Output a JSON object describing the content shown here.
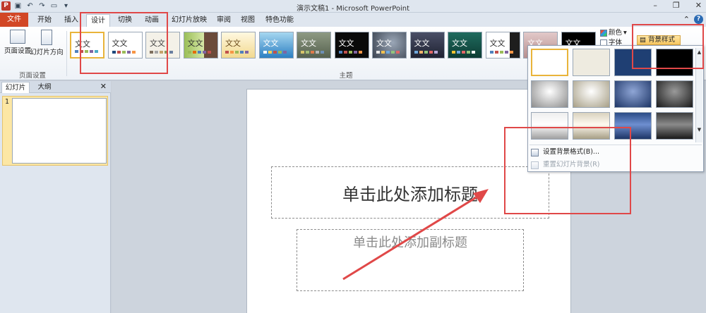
{
  "window": {
    "title": "演示文稿1 - Microsoft PowerPoint",
    "qat_icons": [
      "app-icon",
      "save-icon",
      "undo-icon",
      "redo-icon",
      "new-slide-icon",
      "customize-icon"
    ],
    "controls": {
      "minimize": "–",
      "restore": "❐",
      "close": "✕"
    }
  },
  "ribbon_tabs": [
    {
      "label": "文件",
      "kind": "file"
    },
    {
      "label": "开始"
    },
    {
      "label": "插入"
    },
    {
      "label": "设计",
      "active": true
    },
    {
      "label": "切换"
    },
    {
      "label": "动画"
    },
    {
      "label": "幻灯片放映"
    },
    {
      "label": "审阅"
    },
    {
      "label": "视图"
    },
    {
      "label": "特色功能"
    }
  ],
  "ribbon": {
    "page_setup": {
      "btn1": "页面设置",
      "btn2": "幻灯片方向",
      "group_label": "页面设置"
    },
    "themes": {
      "group_label": "主题",
      "thumb_text": "文文",
      "items": [
        {
          "bg": "#ffffff",
          "fg": "#333333",
          "bars": [
            "#4f81bd",
            "#c0504d",
            "#9bbb59",
            "#8064a2",
            "#4bacc6"
          ],
          "selected": true
        },
        {
          "bg": "#ffffff",
          "fg": "#333333",
          "bars": [
            "#1f497d",
            "#c0504d",
            "#9bbb59",
            "#8064a2",
            "#f79646"
          ]
        },
        {
          "bg": "#f4f1e8",
          "fg": "#444444",
          "bars": [
            "#7f6f5f",
            "#a5a5a5",
            "#c4a26b",
            "#8a9a5b",
            "#6a7fa0"
          ]
        },
        {
          "bg": "linear-gradient(90deg,#9bbf58,#d7e8a8 60%,#6b4b3a 60%)",
          "fg": "#333333",
          "bars": [
            "#9bbb59",
            "#e46c0a",
            "#4f81bd",
            "#8064a2",
            "#c0504d"
          ]
        },
        {
          "bg": "linear-gradient(#fff8e0,#f2d98f)",
          "fg": "#6b4a1a",
          "bars": [
            "#c0504d",
            "#f79646",
            "#9bbb59",
            "#4f81bd",
            "#8064a2"
          ]
        },
        {
          "bg": "linear-gradient(#a6d7f0,#2d7fc2)",
          "fg": "#ffffff",
          "bars": [
            "#ffffff",
            "#f7d154",
            "#c0504d",
            "#9bbb59",
            "#8064a2"
          ]
        },
        {
          "bg": "linear-gradient(#8e9a83,#56614f)",
          "fg": "#ffffff",
          "bars": [
            "#d9c46a",
            "#a5bd76",
            "#e07a4a",
            "#b7b7b7",
            "#6d8fb5"
          ]
        },
        {
          "bg": "#0a0a0a",
          "fg": "#ffffff",
          "bars": [
            "#4f81bd",
            "#c0504d",
            "#9bbb59",
            "#8064a2",
            "#f79646"
          ]
        },
        {
          "bg": "radial-gradient(circle at 60% 40%,#9aa6b6,#3b4350)",
          "fg": "#ffffff",
          "bars": [
            "#e9e9e9",
            "#f2c14e",
            "#6fa8dc",
            "#93c47d",
            "#e06666"
          ]
        },
        {
          "bg": "linear-gradient(#4a4f66,#1f2233)",
          "fg": "#ffffff",
          "bars": [
            "#6fa8dc",
            "#f6b26b",
            "#93c47d",
            "#e06666",
            "#b4a7d6"
          ]
        },
        {
          "bg": "linear-gradient(#1f6b5e,#0d3c34)",
          "fg": "#ffffff",
          "bars": [
            "#f1c232",
            "#6fa8dc",
            "#e06666",
            "#93c47d",
            "#ffffff"
          ]
        },
        {
          "bg": "linear-gradient(90deg,#ffffff 70%,#1e1e1e 70%)",
          "fg": "#333333",
          "bars": [
            "#4f81bd",
            "#c0504d",
            "#9bbb59",
            "#8064a2",
            "#f79646"
          ]
        },
        {
          "bg": "linear-gradient(#e2c9c9,#b79090)",
          "fg": "#ffffff",
          "bars": [
            "#c0504d",
            "#8064a2",
            "#4f81bd",
            "#9bbb59",
            "#f79646"
          ]
        },
        {
          "bg": "#000000",
          "fg": "#ffffff",
          "bars": [
            "#ffffff",
            "#888888",
            "#666666",
            "#444444",
            "#222222"
          ]
        }
      ]
    },
    "side": {
      "colors": "颜色",
      "fonts": "字体",
      "bg_style": "背景样式"
    }
  },
  "left_pane": {
    "tab_slides": "幻灯片",
    "tab_outline": "大纲",
    "close": "✕",
    "slide_number": "1"
  },
  "slide": {
    "title_placeholder": "单击此处添加标题",
    "subtitle_placeholder": "单击此处添加副标题"
  },
  "bg_dropdown": {
    "swatches": [
      {
        "bg": "#ffffff",
        "selected": true
      },
      {
        "bg": "#eeebe0"
      },
      {
        "bg": "#1f3f73"
      },
      {
        "bg": "#000000"
      },
      {
        "bg": "radial-gradient(ellipse at 50% 40%,#ffffff,#8c8c8c)"
      },
      {
        "bg": "radial-gradient(ellipse at 50% 40%,#ffffff,#a79f86)"
      },
      {
        "bg": "radial-gradient(ellipse at 50% 40%,#8fa6d6,#1d3566)"
      },
      {
        "bg": "radial-gradient(ellipse at 50% 40%,#9a9a9a,#1a1a1a)"
      },
      {
        "bg": "linear-gradient(#eeeeee,#ffffff 45%,#a0a0a0)"
      },
      {
        "bg": "linear-gradient(#d9d2bf,#fffaf0 45%,#a79f86)"
      },
      {
        "bg": "linear-gradient(#2b4c86,#6e8fd0 45%,#1d3566)"
      },
      {
        "bg": "linear-gradient(#3d3d3d,#8a8a8a 45%,#1a1a1a)"
      }
    ],
    "menu": [
      {
        "label": "设置背景格式(B)...",
        "enabled": true
      },
      {
        "label": "重置幻灯片背景(R)",
        "enabled": false
      }
    ]
  },
  "colors": {
    "annotation_red": "#e04848",
    "file_tab": "#d24726",
    "highlight": "#f8c65e"
  }
}
